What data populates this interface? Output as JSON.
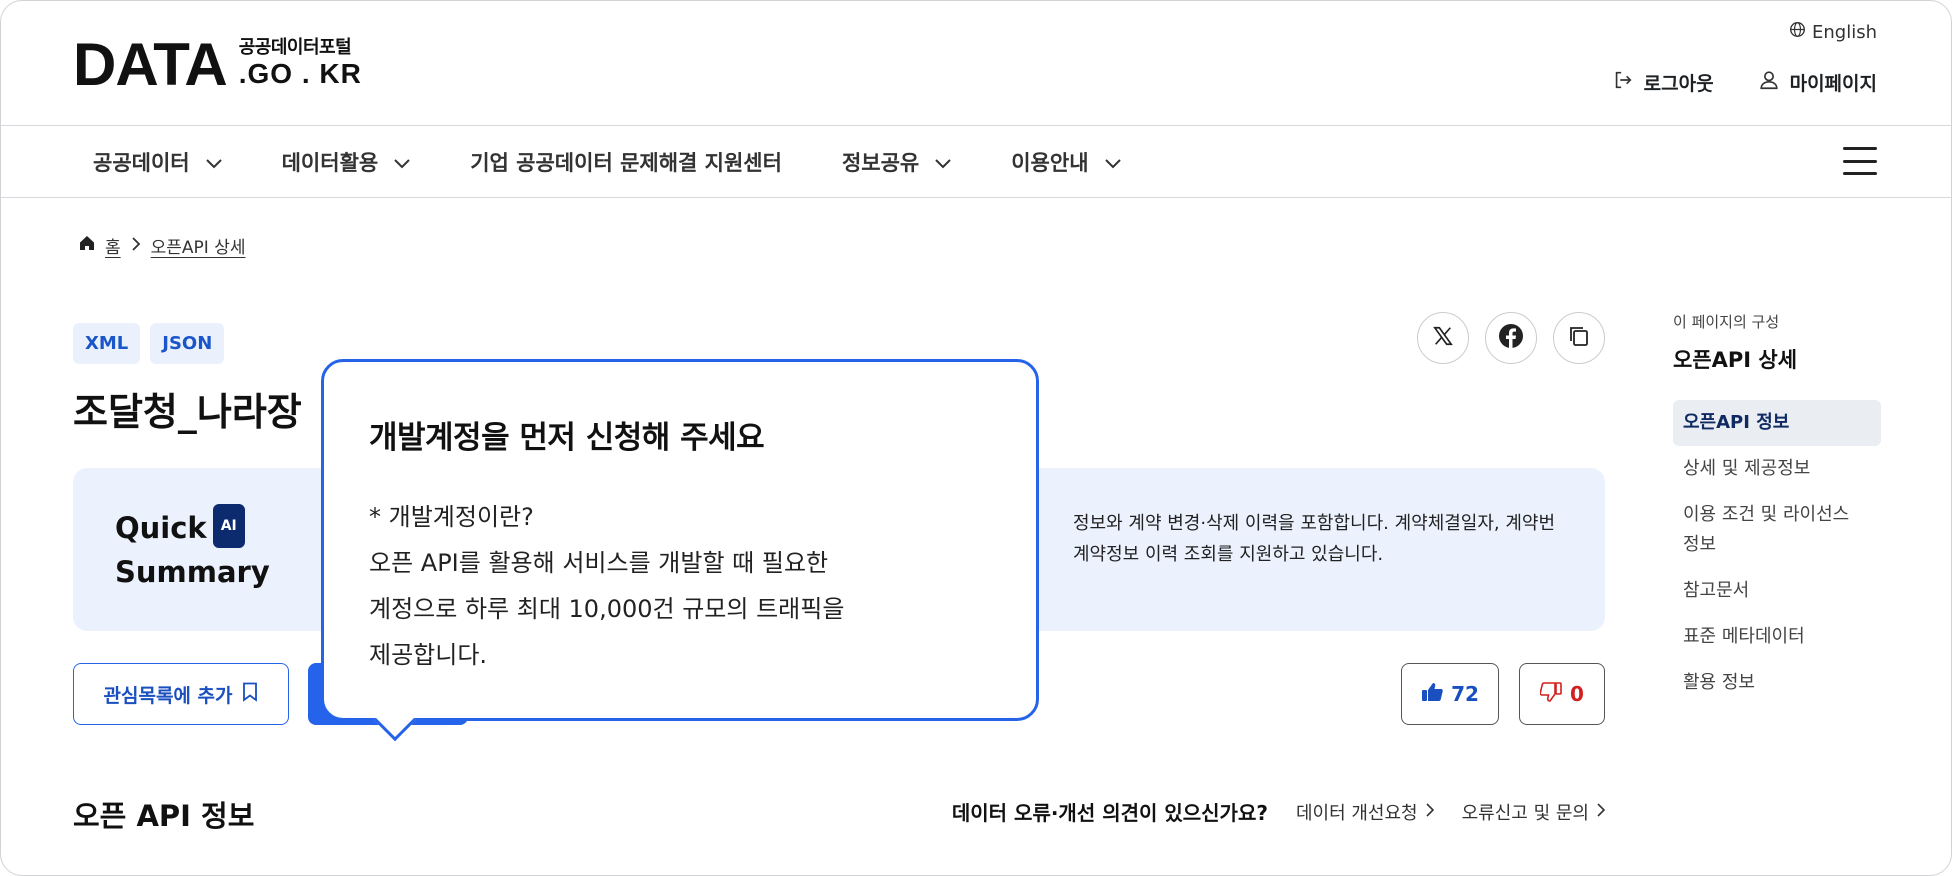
{
  "header": {
    "logo": {
      "main": "DATA",
      "subtitle": "공공데이터포털",
      "domain": ".GO . KR"
    },
    "language": "English",
    "logout": "로그아웃",
    "mypage": "마이페이지"
  },
  "nav": {
    "items": [
      {
        "label": "공공데이터"
      },
      {
        "label": "데이터활용"
      },
      {
        "label": "기업 공공데이터 문제해결 지원센터"
      },
      {
        "label": "정보공유"
      },
      {
        "label": "이용안내"
      }
    ]
  },
  "breadcrumb": {
    "home": "홈",
    "current": "오픈API 상세"
  },
  "dataset": {
    "tags": [
      "XML",
      "JSON"
    ],
    "title_visible": "조달청_나라장"
  },
  "quick_summary": {
    "title_line1": "Quick",
    "ai_badge": "AI",
    "title_line2": "Summary",
    "text_line1": "정보와 계약 변경·삭제 이력을 포함합니다. 계약체결일자, 계약번",
    "text_line2": "계약정보 이력 조회를 지원하고 있습니다."
  },
  "actions": {
    "favorite": "관심목록에 추가",
    "like_count": "72",
    "dislike_count": "0"
  },
  "section": {
    "title": "오픈 API 정보",
    "feedback_question": "데이터 오류·개선 의견이 있으신가요?",
    "improve_link": "데이터 개선요청",
    "report_link": "오류신고 및 문의"
  },
  "toc": {
    "caption": "이 페이지의 구성",
    "title": "오픈API 상세",
    "items": [
      {
        "label": "오픈API 정보"
      },
      {
        "label": "상세 및 제공정보"
      },
      {
        "label": "이용 조건 및 라이선스 정보"
      },
      {
        "label": "참고문서"
      },
      {
        "label": "표준 메타데이터"
      },
      {
        "label": "활용 정보"
      }
    ]
  },
  "popup": {
    "title": "개발계정을 먼저 신청해 주세요",
    "lines": [
      "* 개발계정이란?",
      "오픈 API를 활용해 서비스를 개발할 때 필요한",
      "계정으로 하루 최대 10,000건 규모의 트래픽을",
      "제공합니다."
    ]
  },
  "colors": {
    "accent": "#2563eb",
    "summary_bg": "#ebf2fe",
    "dislike": "#d21f1f"
  },
  "icons": [
    "globe-icon",
    "logout-icon",
    "user-icon",
    "chevron-down-icon",
    "hamburger-menu-icon",
    "home-icon",
    "chevron-right-icon",
    "x-share-icon",
    "facebook-share-icon",
    "copy-link-icon",
    "bookmark-icon",
    "thumbs-up-icon",
    "thumbs-down-icon"
  ]
}
